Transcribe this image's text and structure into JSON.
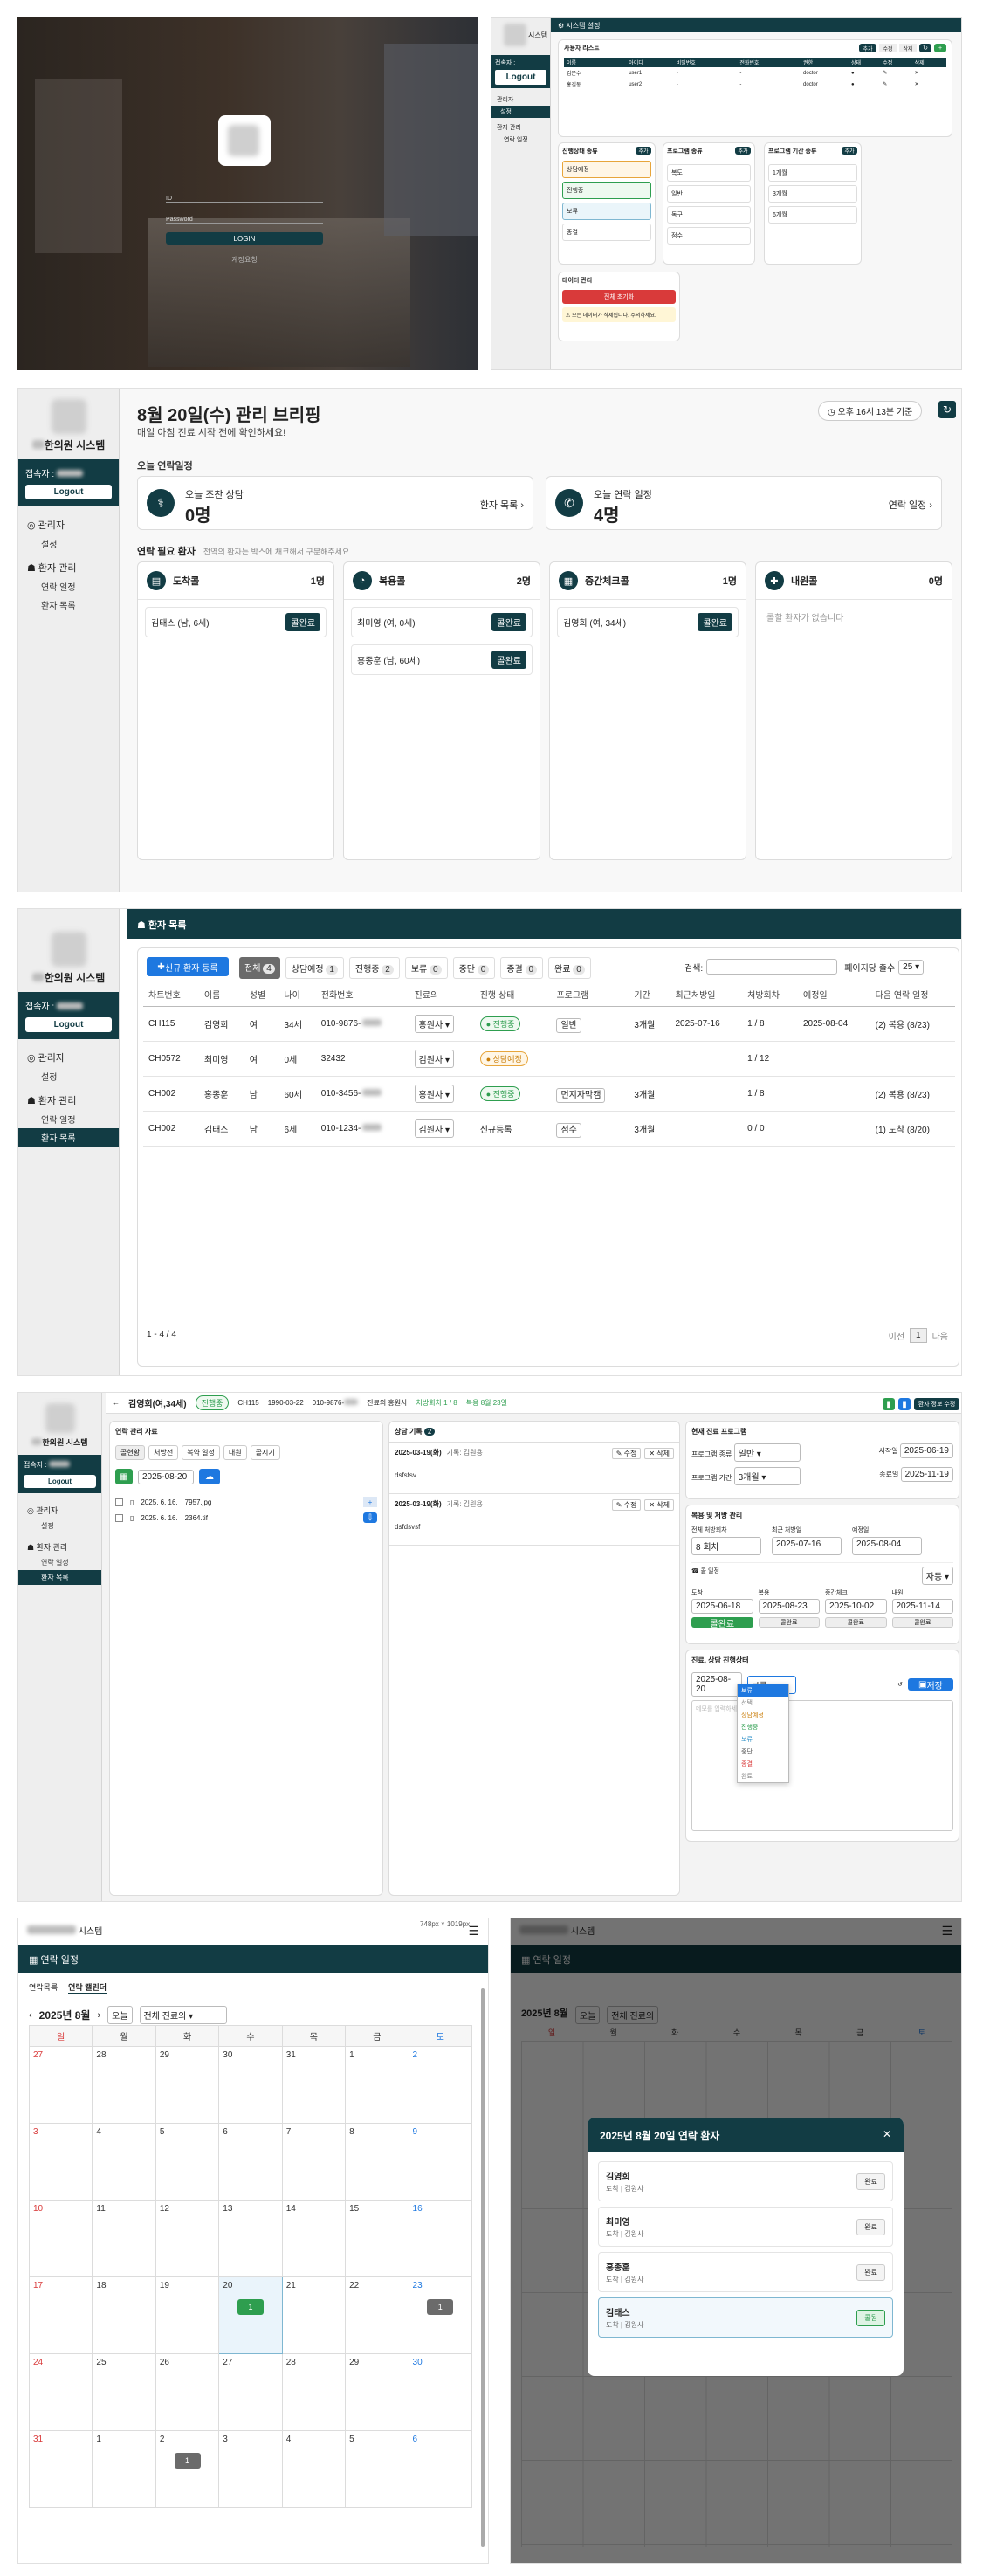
{
  "login": {
    "button": "LOGIN",
    "link": "계정요청",
    "id_placeholder": "ID",
    "pw_placeholder": "Password"
  },
  "admin": {
    "header_title": "시스템 설정",
    "brand": "시스템",
    "who": "접속자 :",
    "logout": "Logout",
    "nav_admin": "관리자",
    "nav_settings": "설정",
    "nav_patient": "환자 관리",
    "nav_contacts": "연락 일정",
    "user_list_title": "사용자 리스트",
    "user_btns": [
      "추가",
      "수정",
      "삭제"
    ],
    "user_cols": [
      "이름",
      "아이디",
      "비밀번호",
      "전화번호",
      "권한",
      "상태",
      "수정",
      "삭제"
    ],
    "users": [
      {
        "name": "김문수",
        "id": "user1",
        "pw": "-",
        "phone": "-",
        "role": "doctor"
      },
      {
        "name": "홍길동",
        "id": "user2",
        "pw": "-",
        "phone": "-",
        "role": "doctor"
      }
    ],
    "box1_title": "진행상태 종류",
    "box1_items": [
      "상담예정",
      "진행중",
      "보류",
      "종결"
    ],
    "box2_title": "프로그램 종류",
    "box2_items": [
      "복도",
      "일반",
      "독구",
      "점수"
    ],
    "box3_title": "프로그램 기간 종류",
    "box3_items": [
      "1개월",
      "3개월",
      "6개월"
    ],
    "add_btn": "추가",
    "data_title": "데이터 관리",
    "data_btn": "전체 초기화",
    "data_warn": "⚠ 모든 데이터가 삭제됩니다. 주의하세요."
  },
  "dash": {
    "brand": "한의원 시스템",
    "who": "접속자 :",
    "logout": "Logout",
    "nav_admin": "관리자",
    "nav_settings": "설정",
    "nav_patient": "환자 관리",
    "nav_contacts": "연락 일정",
    "nav_list": "환자 목록",
    "title": "8월 20일(수) 관리 브리핑",
    "subtitle": "매일 아침 진료 시작 전에 확인하세요!",
    "time": "오후 16시 13분 기준",
    "section1": "오늘 연락일정",
    "card1_label": "오늘 조찬 상담",
    "card1_value": "0명",
    "card1_link": "환자 목록",
    "card2_label": "오늘 연락 일정",
    "card2_value": "4명",
    "card2_link": "연락 일정",
    "section2": "연락 필요 환자",
    "section2_hint": "전역의 환자는 박스에 채크해서 구분해주세요",
    "cols": [
      {
        "title": "도착콜",
        "count": "1명",
        "items": [
          {
            "name": "김태스 (남, 6세)",
            "btn": "콜완료"
          }
        ],
        "empty": ""
      },
      {
        "title": "복용콜",
        "count": "2명",
        "items": [
          {
            "name": "최미영 (여, 0세)",
            "btn": "콜완료"
          },
          {
            "name": "홍종훈 (남, 60세)",
            "btn": "콜완료"
          }
        ],
        "empty": ""
      },
      {
        "title": "중간체크콜",
        "count": "1명",
        "items": [
          {
            "name": "김영희 (여, 34세)",
            "btn": "콜완료"
          }
        ],
        "empty": ""
      },
      {
        "title": "내원콜",
        "count": "0명",
        "items": [],
        "empty": "콜할 환자가 없습니다"
      }
    ]
  },
  "plist": {
    "header": "환자 목록",
    "new_btn": "신규 환자 등록",
    "filters": [
      {
        "label": "전체",
        "count": "4"
      },
      {
        "label": "상담예정",
        "count": "1"
      },
      {
        "label": "진행중",
        "count": "2"
      },
      {
        "label": "보류",
        "count": "0"
      },
      {
        "label": "중단",
        "count": "0"
      },
      {
        "label": "종결",
        "count": "0"
      },
      {
        "label": "완료",
        "count": "0"
      }
    ],
    "search_label": "검색:",
    "page_size_label": "페이지당 출수",
    "page_size": "25",
    "cols": [
      "차트번호",
      "이름",
      "성별",
      "나이",
      "전화번호",
      "진료의",
      "진행 상태",
      "프로그램",
      "기간",
      "최근처방일",
      "처방회차",
      "예정일",
      "다음 연락 일정"
    ],
    "rows": [
      {
        "chart": "CH115",
        "name": "김영희",
        "sex": "여",
        "age": "34세",
        "phone": "010-9876-",
        "doc": "홍원사",
        "status": "진행중",
        "status_kind": "green",
        "program": "일반",
        "period": "3개월",
        "recent": "2025-07-16",
        "count": "1 / 8",
        "due": "2025-08-04",
        "next": "(2) 복용 (8/23)"
      },
      {
        "chart": "CH0572",
        "name": "최미영",
        "sex": "여",
        "age": "0세",
        "phone": "32432",
        "doc": "김원사",
        "status": "상담예정",
        "status_kind": "orange",
        "program": "",
        "period": "",
        "recent": "",
        "count": "1 / 12",
        "due": "",
        "next": ""
      },
      {
        "chart": "CH002",
        "name": "홍종훈",
        "sex": "남",
        "age": "60세",
        "phone": "010-3456-",
        "doc": "홍원사",
        "status": "진행중",
        "status_kind": "green",
        "program": "먼지자막캠",
        "period": "3개월",
        "recent": "",
        "count": "1 / 8",
        "due": "",
        "next": "(2) 복용 (8/23)"
      },
      {
        "chart": "CH002",
        "name": "김태스",
        "sex": "남",
        "age": "6세",
        "phone": "010-1234-",
        "doc": "김원사",
        "status": "신규등록",
        "status_kind": "plain",
        "program": "점수",
        "period": "3개월",
        "recent": "",
        "count": "0 / 0",
        "due": "",
        "next": "(1) 도착 (8/20)"
      }
    ],
    "footer": "1 - 4 / 4",
    "prev": "이전",
    "page": "1",
    "next": "다음"
  },
  "detail": {
    "patient": "김영희(여,34세)",
    "status": "진행중",
    "chart": "CH115",
    "birth": "1990-03-22",
    "phone": "010-9876-",
    "doc": "진료의 홍원사",
    "rx": "처방회차 1 / 8",
    "next": "복용 8월 23일",
    "right_btn": "환자 정보 수정",
    "left_title": "연락 관리 자료",
    "left_tabs": [
      "콜현황",
      "처방전",
      "복약 일정",
      "내원",
      "콜시기"
    ],
    "date1": "2025-08-20",
    "files": [
      {
        "date": "2025. 6. 16.",
        "name": "7957.jpg"
      },
      {
        "date": "2025. 6. 16.",
        "name": "2364.tif"
      }
    ],
    "mid_title": "상담 기록",
    "mid_count": "2",
    "records": [
      {
        "date": "2025-03-19(화)",
        "who": "기록: 김원용",
        "text": "dsfsfsv",
        "edit": "수정",
        "del": "삭제"
      },
      {
        "date": "2025-03-19(화)",
        "who": "기록: 김원용",
        "text": "dsfdsvsf",
        "edit": "수정",
        "del": "삭제"
      }
    ],
    "prog_title": "현재 진료 프로그램",
    "prog_fields": [
      {
        "label": "프로그램 종류",
        "value": "일반"
      },
      {
        "label": "프로그램 기간",
        "value": "3개월"
      }
    ],
    "prog_start_label": "시작일",
    "prog_start": "2025-06-19",
    "prog_end_label": "종료일",
    "prog_end": "2025-11-19",
    "rx_title": "복용 및 처방 관리",
    "rx_labels": [
      "전체 처방회차",
      "최근 처방일",
      "예정일"
    ],
    "rx_vals": [
      "8",
      "2025-07-16",
      "2025-08-04"
    ],
    "rx_unit": "회차",
    "rx_sub": "콜 일정",
    "rx_sel": "자동",
    "call_labels": [
      "도착",
      "복용",
      "중간체크",
      "내원"
    ],
    "call_dates": [
      "2025-06-18",
      "2025-08-23",
      "2025-10-02",
      "2025-11-14"
    ],
    "call_btns": [
      "콜완료",
      "콜완료",
      "콜완료",
      "콜완료"
    ],
    "state_title": "진료, 상담 진행상태",
    "state_date": "2025-08-20",
    "state_sel": "보류",
    "state_save": "저장",
    "state_options": [
      "보류",
      "선택",
      "상담예정",
      "진행중",
      "보류",
      "중단",
      "종결",
      "완료"
    ],
    "state_memo_placeholder": "메모를 입력하세요"
  },
  "cal": {
    "brand": "시스템",
    "dims": "748px × 1019px",
    "header": "연락 일정",
    "tabs": [
      "연락목록",
      "연락 캘린더"
    ],
    "month": "2025년 8월",
    "today_btn": "오늘",
    "filter": "전체 진료의",
    "days": [
      "일",
      "월",
      "화",
      "수",
      "목",
      "금",
      "토"
    ],
    "weeks": [
      [
        "27",
        "28",
        "29",
        "30",
        "31",
        "1",
        "2"
      ],
      [
        "3",
        "4",
        "5",
        "6",
        "7",
        "8",
        "9"
      ],
      [
        "10",
        "11",
        "12",
        "13",
        "14",
        "15",
        "16"
      ],
      [
        "17",
        "18",
        "19",
        "20",
        "21",
        "22",
        "23"
      ],
      [
        "24",
        "25",
        "26",
        "27",
        "28",
        "29",
        "30"
      ],
      [
        "31",
        "1",
        "2",
        "3",
        "4",
        "5",
        "6"
      ]
    ],
    "badge_today": "1",
    "badge_23": "1",
    "badge_sep2": "1"
  },
  "modal": {
    "title": "2025년 8월 20일 연락 환자",
    "items": [
      {
        "name": "김영희",
        "sub": "도착 | 김원사",
        "btn": "완료"
      },
      {
        "name": "최미영",
        "sub": "도착 | 김원사",
        "btn": "완료"
      },
      {
        "name": "홍종훈",
        "sub": "도착 | 김원사",
        "btn": "완료"
      },
      {
        "name": "김태스",
        "sub": "도착 | 김원사",
        "btn": "콜됨"
      }
    ],
    "days": [
      "일",
      "월",
      "화",
      "수",
      "목",
      "금",
      "토"
    ]
  }
}
